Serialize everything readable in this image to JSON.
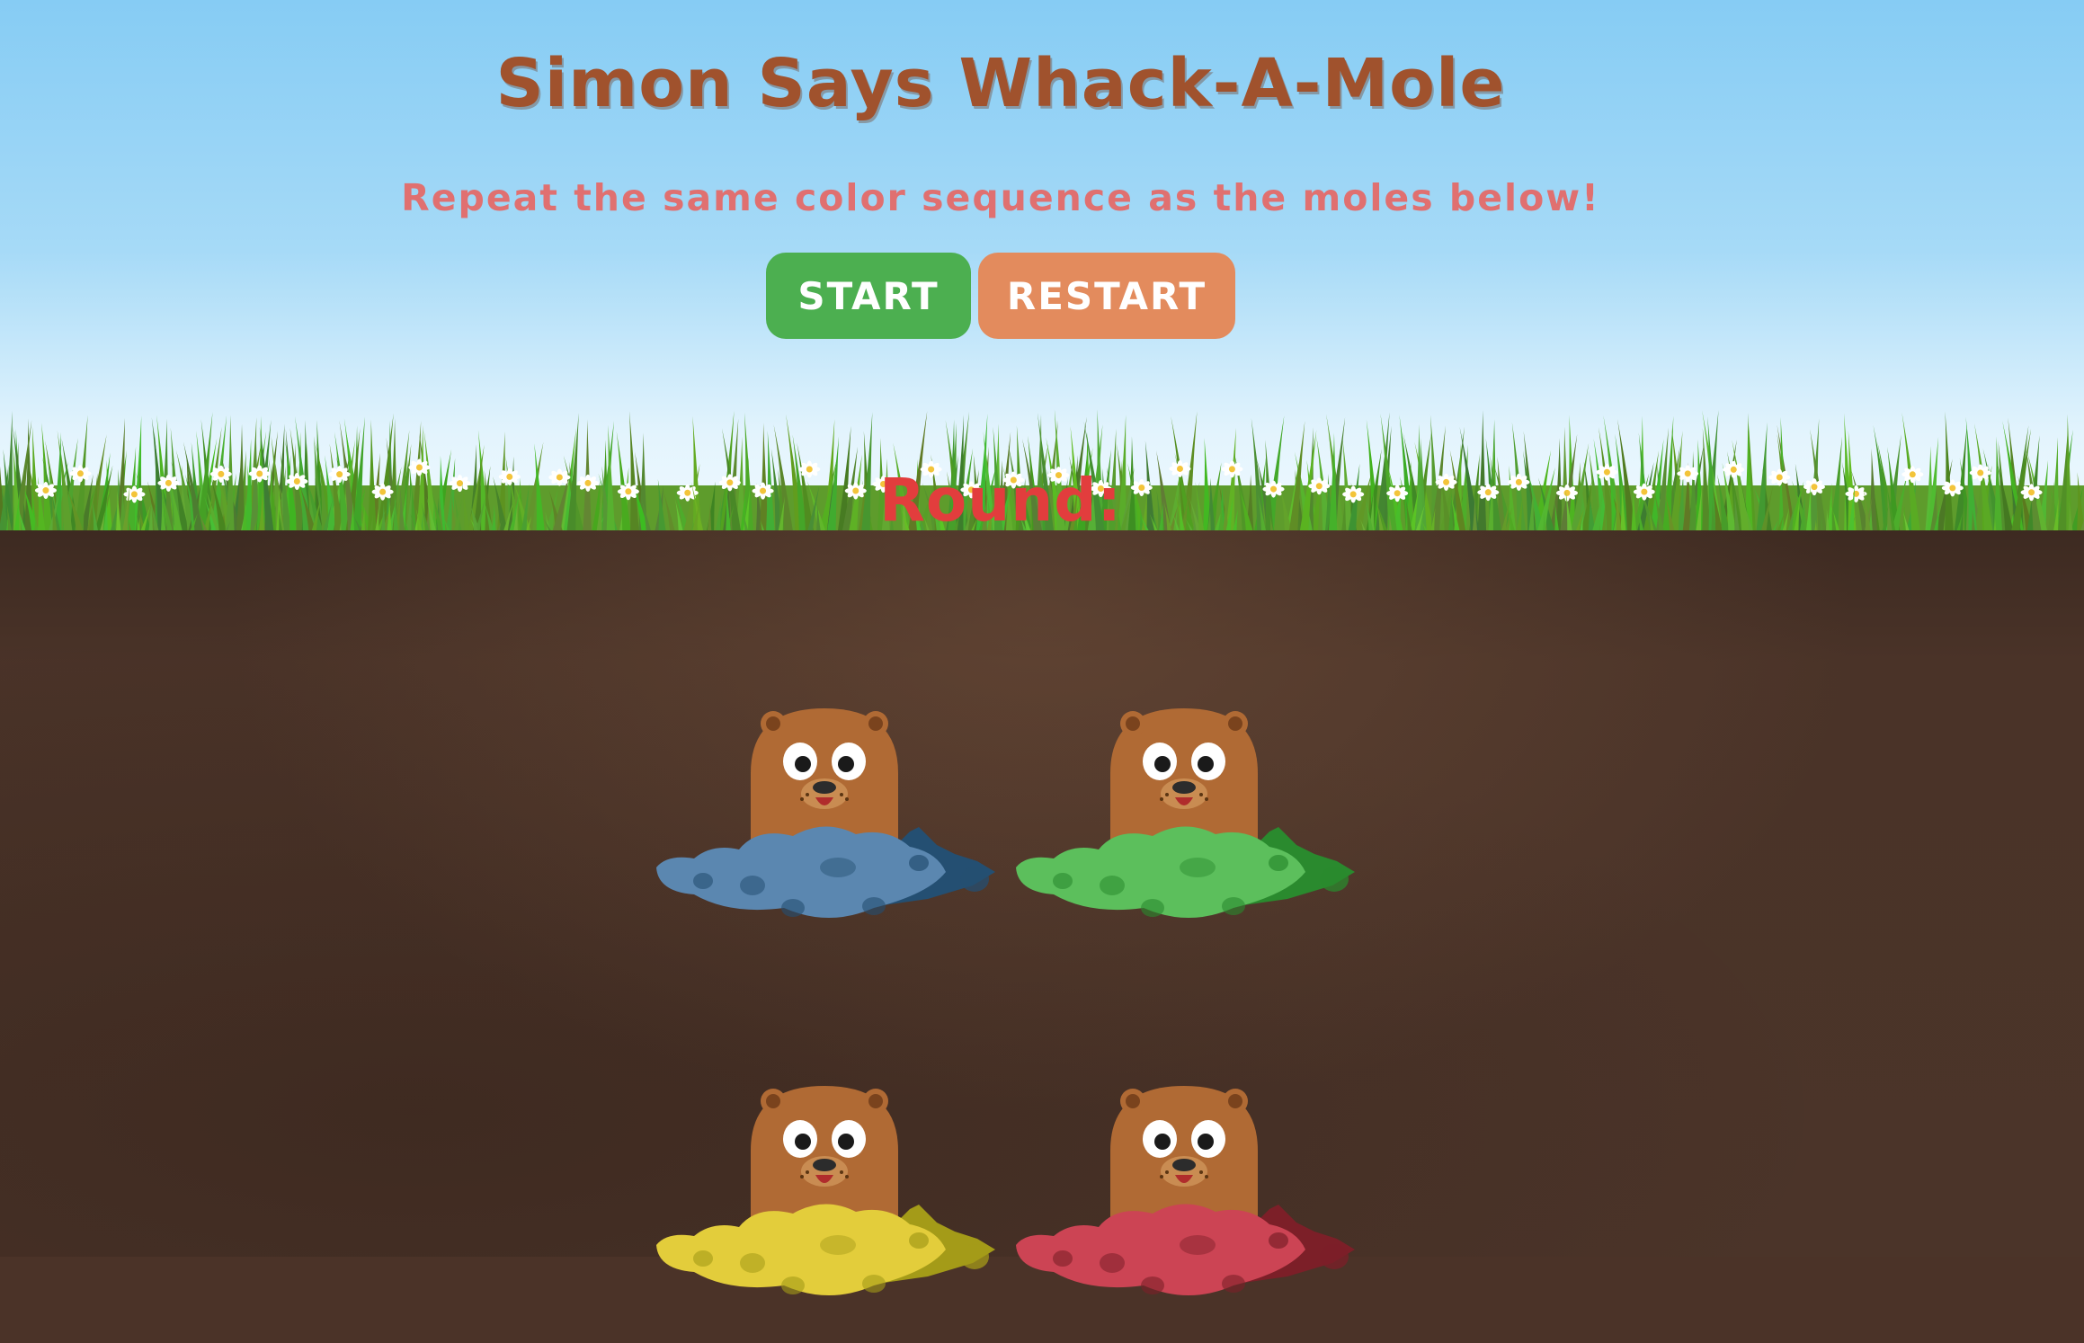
{
  "title": "Simon Says Whack-A-Mole",
  "instructions": "Repeat the same color sequence as the moles below!",
  "controls": {
    "start_label": "Start",
    "restart_label": "Restart"
  },
  "round": {
    "label": "Round:",
    "value": ""
  },
  "moles": [
    {
      "name": "blue",
      "dirt_color": "#5b87b0",
      "dirt_shadow": "#244f72"
    },
    {
      "name": "green",
      "dirt_color": "#5cbf5c",
      "dirt_shadow": "#2a8a2e"
    },
    {
      "name": "yellow",
      "dirt_color": "#e3cd3b",
      "dirt_shadow": "#a49b18"
    },
    {
      "name": "red",
      "dirt_color": "#cc4454",
      "dirt_shadow": "#7c1f28"
    }
  ],
  "colors": {
    "title": "#a0522d",
    "subtitle": "#e07070",
    "start_button": "#4caf50",
    "restart_button": "#e38b5d",
    "round_text": "#e23d3d",
    "mole_fur": "#b06a34",
    "soil": "#4b3429"
  }
}
